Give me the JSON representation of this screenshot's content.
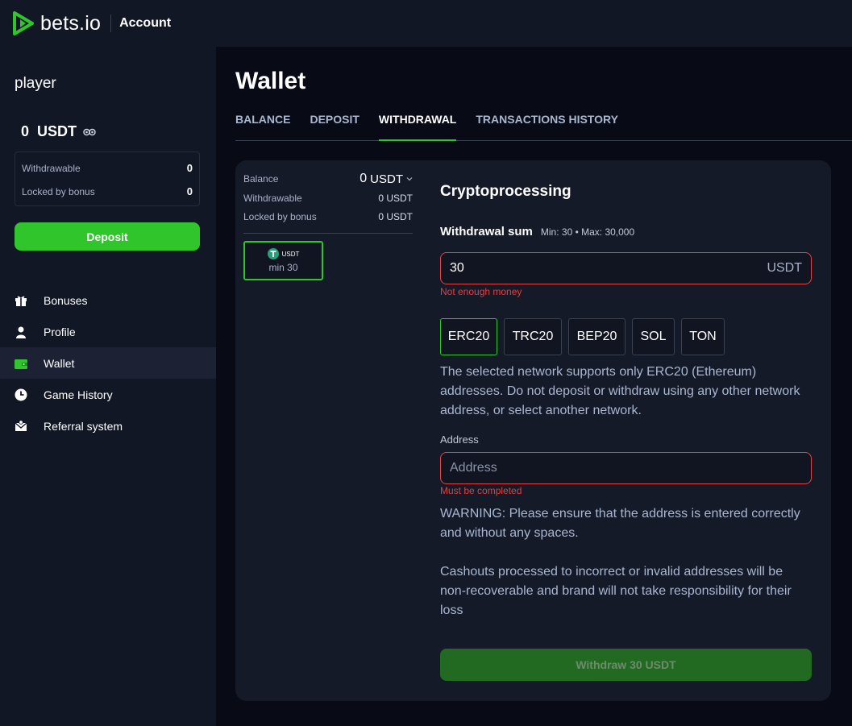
{
  "header": {
    "brand": "bets.io",
    "section": "Account",
    "brand_color": "#2fc52b"
  },
  "sidebar": {
    "username": "player",
    "balance": "0  USDT",
    "withdrawable_label": "Withdrawable",
    "withdrawable_value": "0",
    "locked_label": "Locked by bonus",
    "locked_value": "0",
    "deposit_label": "Deposit",
    "nav": [
      {
        "label": "Bonuses",
        "icon": "gift-icon"
      },
      {
        "label": "Profile",
        "icon": "user-icon"
      },
      {
        "label": "Wallet",
        "icon": "wallet-icon",
        "active": true
      },
      {
        "label": "Game History",
        "icon": "clock-icon"
      },
      {
        "label": "Referral system",
        "icon": "envelope-icon"
      }
    ]
  },
  "page": {
    "title": "Wallet",
    "tabs": [
      "BALANCE",
      "DEPOSIT",
      "WITHDRAWAL",
      "TRANSACTIONS HISTORY"
    ],
    "active_tab": "WITHDRAWAL"
  },
  "balance_panel": {
    "balance_label": "Balance",
    "balance_amount": "0",
    "balance_currency": "USDT",
    "withdrawable_label": "Withdrawable",
    "withdrawable_value": "0 USDT",
    "locked_label": "Locked by bonus",
    "locked_value": "0 USDT",
    "coin": {
      "name": "USDT",
      "min": "min 30"
    }
  },
  "withdraw_form": {
    "title": "Cryptoprocessing",
    "sum_label": "Withdrawal sum",
    "sum_hint": "Min: 30 • Max: 30,000",
    "sum_value": "30",
    "sum_currency": "USDT",
    "sum_error": "Not enough money",
    "networks": [
      "ERC20",
      "TRC20",
      "BEP20",
      "SOL",
      "TON"
    ],
    "active_network": "ERC20",
    "network_note": "The selected network supports only ERC20 (Ethereum) addresses. Do not deposit or withdraw using any other network address, or select another network.",
    "address_label": "Address",
    "address_placeholder": "Address",
    "address_error": "Must be completed",
    "warning": "WARNING: Please ensure that the address is entered correctly and without any spaces.",
    "cashout_note": "Cashouts processed to incorrect or invalid addresses will be non-recoverable and brand will not take responsibility for their loss",
    "submit_label": "Withdraw 30 USDT"
  }
}
